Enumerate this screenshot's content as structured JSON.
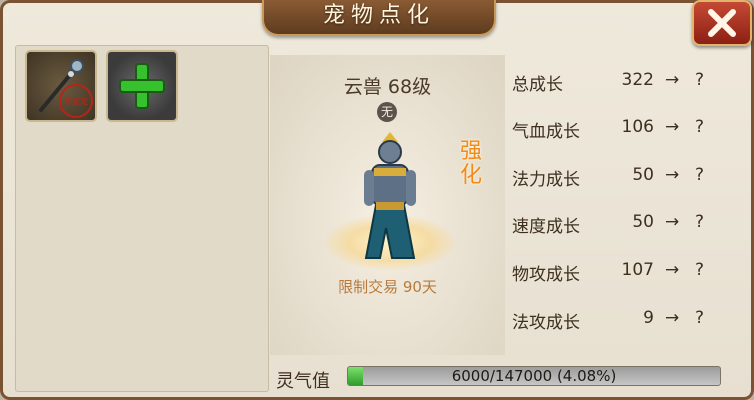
{
  "window": {
    "title": "宠物点化"
  },
  "pet": {
    "name_level": "云兽 68级",
    "badge": "无",
    "trade_limit": "限制交易 90天",
    "strengthen_label": "强化"
  },
  "slots": {
    "item_seal_text": "未鉴定",
    "icons": [
      "staff-item-icon",
      "add-plus-icon"
    ]
  },
  "stats": [
    {
      "label": "总成长",
      "value": "322",
      "arrow": "→",
      "next": "?"
    },
    {
      "label": "气血成长",
      "value": "106",
      "arrow": "→",
      "next": "?"
    },
    {
      "label": "法力成长",
      "value": "50",
      "arrow": "→",
      "next": "?"
    },
    {
      "label": "速度成长",
      "value": "50",
      "arrow": "→",
      "next": "?"
    },
    {
      "label": "物攻成长",
      "value": "107",
      "arrow": "→",
      "next": "?"
    },
    {
      "label": "法攻成长",
      "value": "9",
      "arrow": "→",
      "next": "?"
    }
  ],
  "lingqi": {
    "label": "灵气值",
    "text": "6000/147000 (4.08%)",
    "fraction": 0.0408
  },
  "colors": {
    "accent": "#ef8a1b",
    "frame": "#7a5432",
    "close": "#c54a34",
    "progress": "#2f9d2c"
  }
}
